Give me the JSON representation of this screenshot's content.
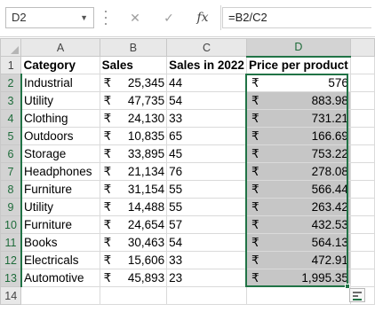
{
  "name_box": "D2",
  "formula": "=B2/C2",
  "icons": {
    "cancel": "✕",
    "enter": "✓",
    "fx": "fx"
  },
  "columns": [
    "A",
    "B",
    "C",
    "D"
  ],
  "headers": [
    "Category",
    "Sales",
    "Sales in 2022",
    "Price per product"
  ],
  "currency": "₹",
  "rows": [
    {
      "n": "2",
      "category": "Industrial",
      "sales": "25,345",
      "sales2022": "44",
      "ppp": "576"
    },
    {
      "n": "3",
      "category": "Utility",
      "sales": "47,735",
      "sales2022": "54",
      "ppp": "883.98"
    },
    {
      "n": "4",
      "category": "Clothing",
      "sales": "24,130",
      "sales2022": "33",
      "ppp": "731.21"
    },
    {
      "n": "5",
      "category": "Outdoors",
      "sales": "10,835",
      "sales2022": "65",
      "ppp": "166.69"
    },
    {
      "n": "6",
      "category": "Storage",
      "sales": "33,895",
      "sales2022": "45",
      "ppp": "753.22"
    },
    {
      "n": "7",
      "category": "Headphones",
      "sales": "21,134",
      "sales2022": "76",
      "ppp": "278.08"
    },
    {
      "n": "8",
      "category": "Furniture",
      "sales": "31,154",
      "sales2022": "55",
      "ppp": "566.44"
    },
    {
      "n": "9",
      "category": "Utility",
      "sales": "14,488",
      "sales2022": "55",
      "ppp": "263.42"
    },
    {
      "n": "10",
      "category": "Furniture",
      "sales": "24,654",
      "sales2022": "57",
      "ppp": "432.53"
    },
    {
      "n": "11",
      "category": "Books",
      "sales": "30,463",
      "sales2022": "54",
      "ppp": "564.13"
    },
    {
      "n": "12",
      "category": "Electricals",
      "sales": "15,606",
      "sales2022": "33",
      "ppp": "472.91"
    },
    {
      "n": "13",
      "category": "Automotive",
      "sales": "45,893",
      "sales2022": "23",
      "ppp": "1,995.35"
    }
  ],
  "row_numbers_top": "1",
  "row_numbers_bottom": "14",
  "colors": {
    "selection_green": "#217346",
    "selection_fill": "#c6c6c6",
    "header_gray": "#e8e8e8"
  }
}
